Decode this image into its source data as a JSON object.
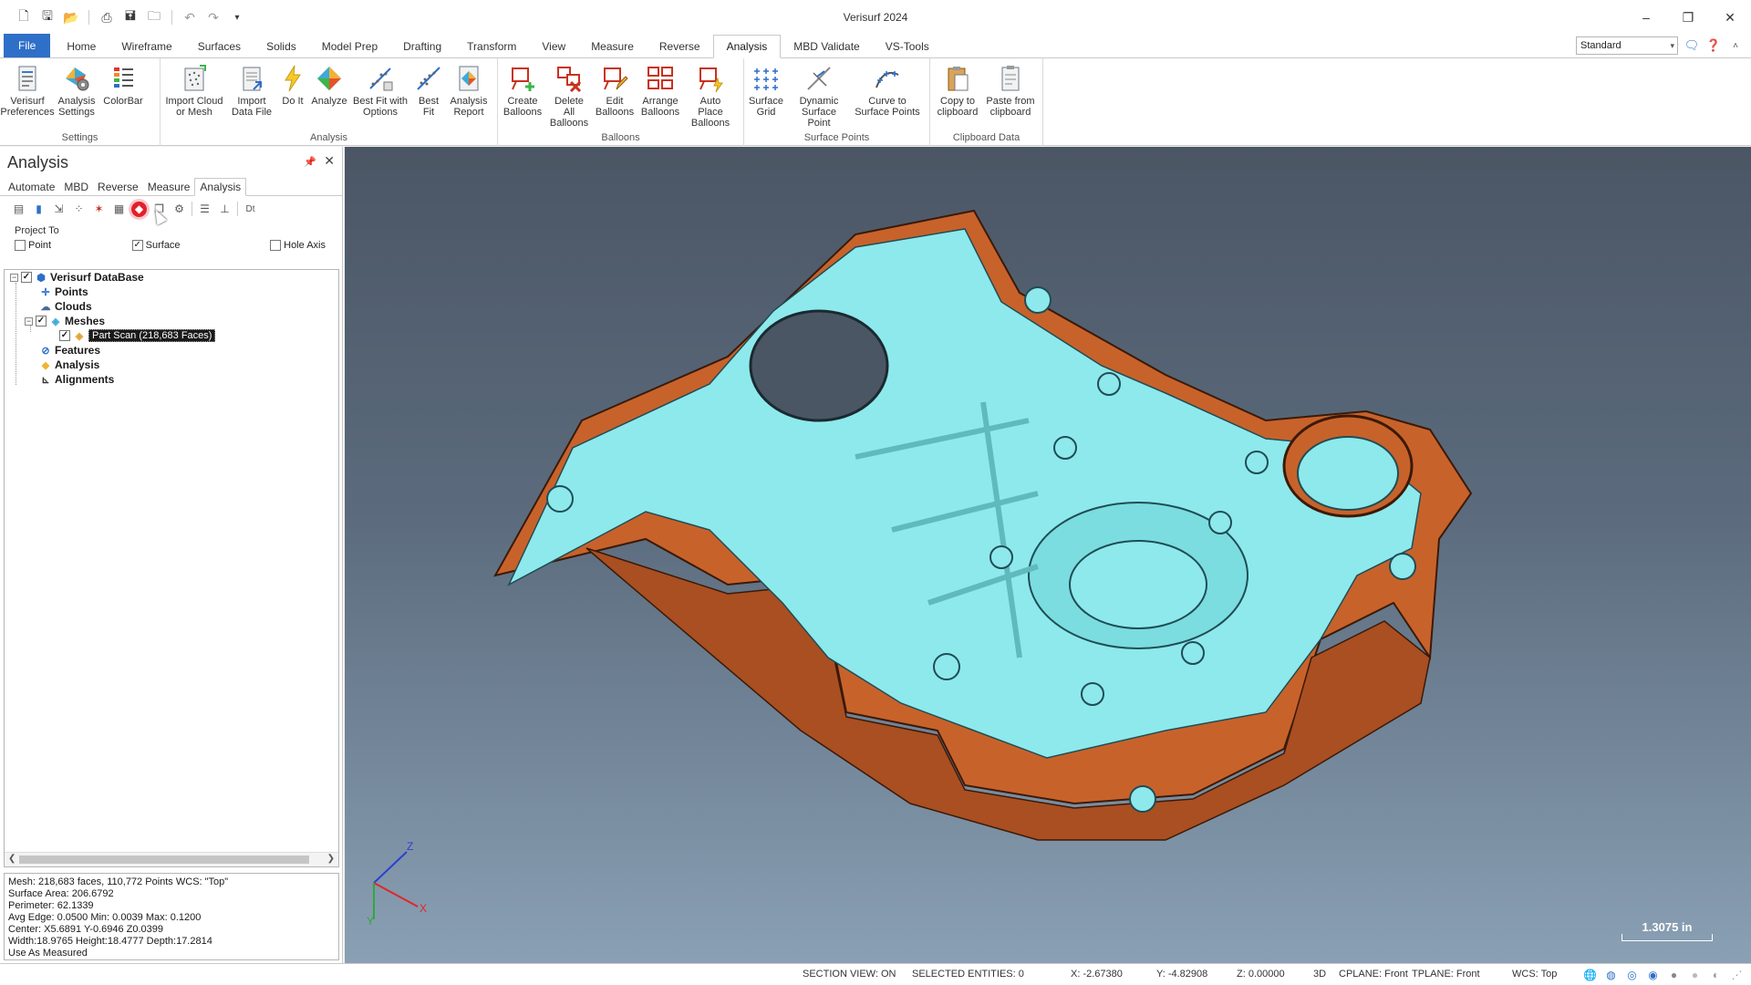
{
  "window": {
    "title": "Verisurf 2024"
  },
  "qat": [
    "new-icon",
    "save-icon",
    "open-icon",
    "print-icon",
    "save-as-icon",
    "folder-icon",
    "undo-icon",
    "redo-icon",
    "customize-icon"
  ],
  "tabs": [
    "File",
    "Home",
    "Wireframe",
    "Surfaces",
    "Solids",
    "Model Prep",
    "Drafting",
    "Transform",
    "View",
    "Measure",
    "Reverse",
    "Analysis",
    "MBD Validate",
    "VS-Tools"
  ],
  "active_tab": "Analysis",
  "workspace": {
    "selected": "Standard"
  },
  "ribbon": {
    "groups": [
      {
        "label": "Settings",
        "buttons": [
          "Verisurf Preferences",
          "Analysis Settings",
          "ColorBar"
        ]
      },
      {
        "label": "Analysis",
        "buttons": [
          "Import Cloud or Mesh",
          "Import Data File",
          "Do It",
          "Analyze",
          "Best Fit with Options",
          "Best Fit",
          "Analysis Report"
        ]
      },
      {
        "label": "Balloons",
        "buttons": [
          "Create Balloons",
          "Delete All Balloons",
          "Edit Balloons",
          "Arrange Balloons",
          "Auto Place Balloons"
        ]
      },
      {
        "label": "Surface Points",
        "buttons": [
          "Surface Grid",
          "Dynamic Surface Point",
          "Curve to Surface Points"
        ]
      },
      {
        "label": "Clipboard Data",
        "buttons": [
          "Copy to clipboard",
          "Paste from clipboard"
        ]
      }
    ]
  },
  "panel": {
    "title": "Analysis",
    "subtabs": [
      "Automate",
      "MBD",
      "Reverse",
      "Measure",
      "Analysis"
    ],
    "active_subtab": "Analysis",
    "project_to": {
      "label": "Project To",
      "point": "Point",
      "surface": "Surface",
      "hole_axis": "Hole Axis",
      "surface_checked": true
    },
    "tree": {
      "root": "Verisurf DataBase",
      "points": "Points",
      "clouds": "Clouds",
      "meshes": "Meshes",
      "part_scan": "Part Scan (218,683 Faces)",
      "features": "Features",
      "analysis": "Analysis",
      "alignments": "Alignments"
    },
    "info": [
      "Mesh: 218,683 faces, 110,772 Points  WCS: \"Top\"",
      "Surface Area: 206.6792",
      "Perimeter: 62.1339",
      "Avg Edge: 0.0500 Min: 0.0039 Max: 0.1200",
      "Center: X5.6891 Y-0.6946 Z0.0399",
      "Width:18.9765 Height:18.4777 Depth:17.2814",
      "Use As Measured"
    ]
  },
  "viewport": {
    "scale": "1.3075 in",
    "axes": {
      "x": "X",
      "y": "Y",
      "z": "Z"
    },
    "colors": {
      "in_tolerance": "#8ee9ec",
      "out_tolerance": "#c8622b"
    }
  },
  "status": {
    "section_view": "SECTION VIEW: ON",
    "selected": "SELECTED ENTITIES: 0",
    "x": "X:   -2.67380",
    "y": "Y:   -4.82908",
    "z": "Z:   0.00000",
    "mode": "3D",
    "cplane": "CPLANE: Front",
    "tplane": "TPLANE: Front",
    "wcs": "WCS: Top"
  }
}
